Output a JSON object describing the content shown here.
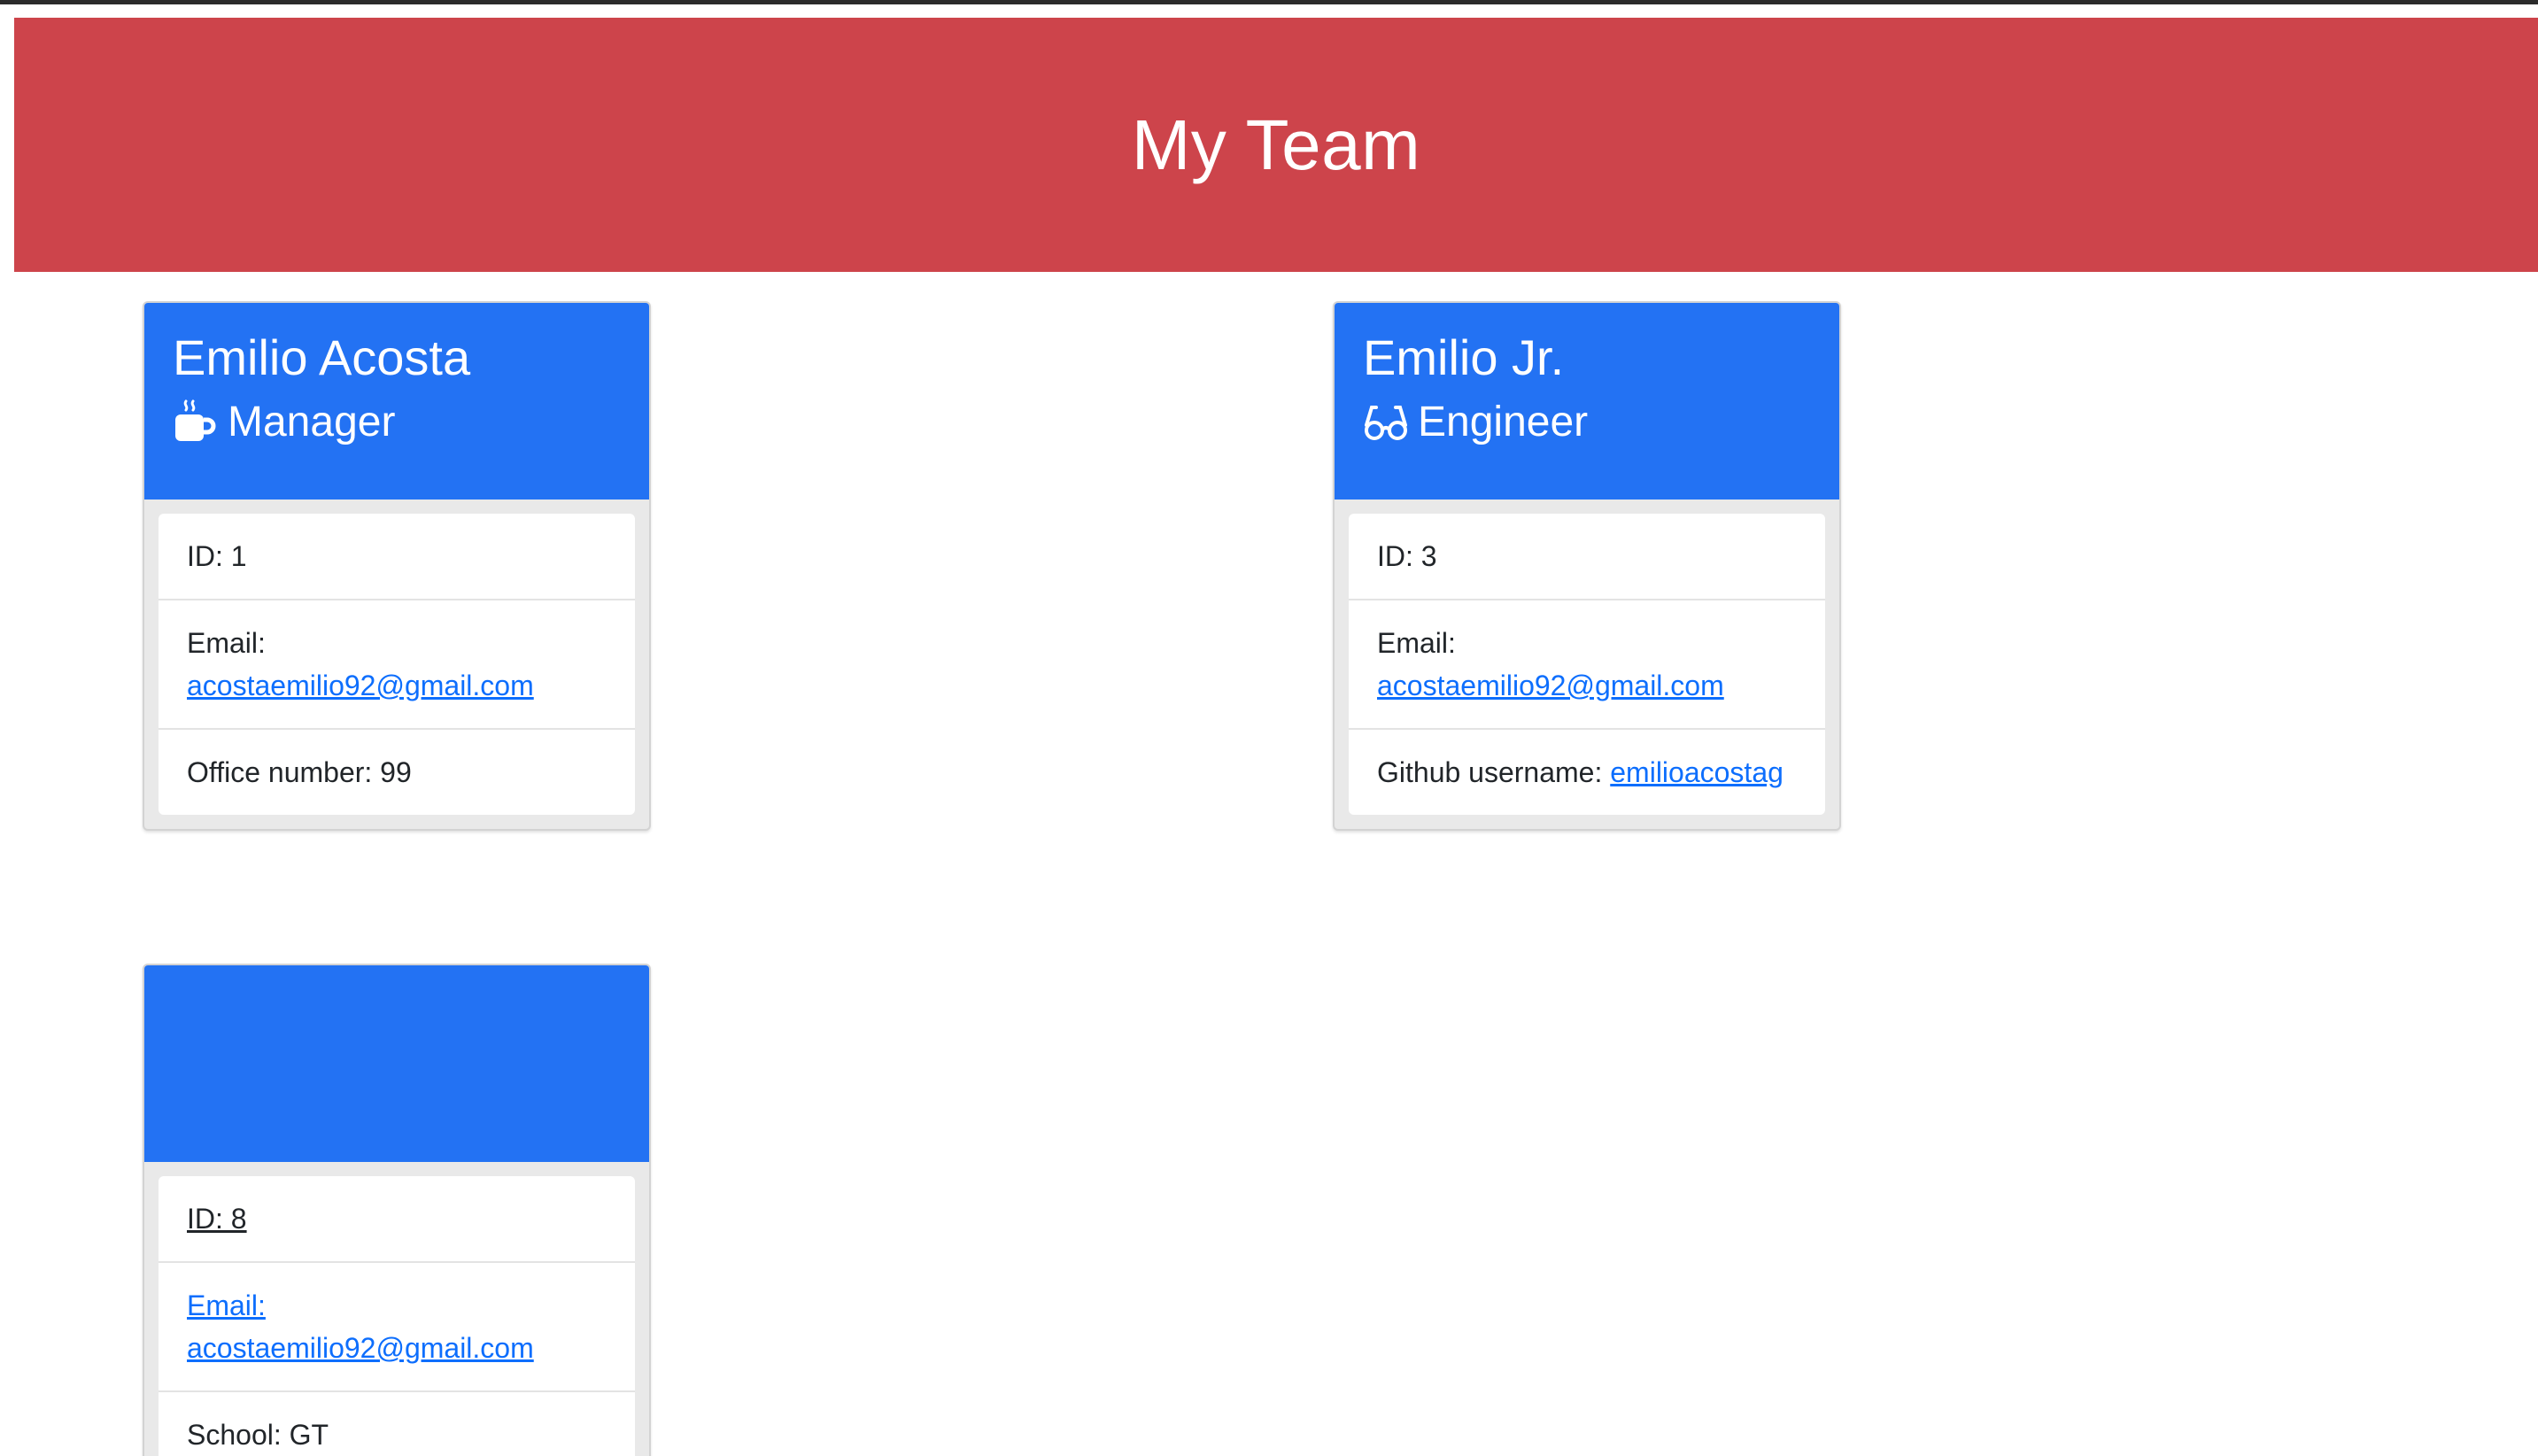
{
  "header": {
    "title": "My Team"
  },
  "colors": {
    "banner": "#cd444b",
    "card_header": "#2372f3",
    "link": "#0d6efd"
  },
  "cards": [
    {
      "name": "Emilio Acosta",
      "role": "Manager",
      "role_icon": "coffee-mug-icon",
      "id_text": "ID: 1",
      "email_label": "Email:",
      "email": "acostaemilio92@gmail.com",
      "extra_label": "Office number: 99"
    },
    {
      "name": "Emilio Jr.",
      "role": "Engineer",
      "role_icon": "glasses-icon",
      "id_text": "ID: 3",
      "email_label": "Email:",
      "email": "acostaemilio92@gmail.com",
      "extra_label": "Github username:",
      "extra_link": "emilioacostag"
    },
    {
      "name": "",
      "role": "",
      "id_text": "ID: 8",
      "email_label": "Email:",
      "email": "acostaemilio92@gmail.com",
      "extra_label": "School: GT"
    }
  ]
}
